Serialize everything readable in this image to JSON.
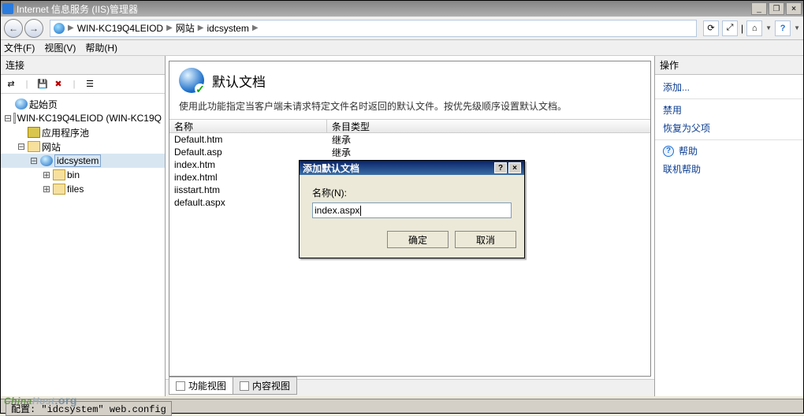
{
  "window": {
    "title": "Internet 信息服务 (IIS)管理器",
    "min_btn": "_",
    "restore_btn": "❐",
    "close_btn": "×"
  },
  "nav": {
    "back": "←",
    "fwd": "→",
    "crumbs": [
      "WIN-KC19Q4LEIOD",
      "网站",
      "idcsystem"
    ],
    "sep": "▶",
    "refresh": "⟳",
    "explore": "⤢",
    "home": "⌂",
    "help": "?"
  },
  "menu": {
    "file": "文件(F)",
    "view": "视图(V)",
    "help": "帮助(H)"
  },
  "left": {
    "header": "连接",
    "tb": {
      "connect": "⇄",
      "save": "💾",
      "delete": "✖",
      "sep": "|"
    },
    "tree": {
      "start": "起始页",
      "host": "WIN-KC19Q4LEIOD (WIN-KC19Q",
      "apppool": "应用程序池",
      "sites": "网站",
      "site": "idcsystem",
      "bin": "bin",
      "files": "files",
      "expand": "⊟",
      "expand2": "⊞"
    }
  },
  "center": {
    "title": "默认文档",
    "desc": "使用此功能指定当客户端未请求特定文件名时返回的默认文件。按优先级顺序设置默认文档。",
    "cols": {
      "name": "名称",
      "type": "条目类型"
    },
    "rows": [
      {
        "name": "Default.htm",
        "type": "继承"
      },
      {
        "name": "Default.asp",
        "type": "继承"
      },
      {
        "name": "index.htm",
        "type": ""
      },
      {
        "name": "index.html",
        "type": ""
      },
      {
        "name": "iisstart.htm",
        "type": ""
      },
      {
        "name": "default.aspx",
        "type": ""
      }
    ],
    "tabs": {
      "features": "功能视图",
      "content": "内容视图"
    }
  },
  "right": {
    "header": "操作",
    "add": "添加...",
    "disable": "禁用",
    "revert": "恢复为父项",
    "help": "帮助",
    "online": "联机帮助"
  },
  "dialog": {
    "title": "添加默认文档",
    "help": "?",
    "close": "×",
    "label": "名称(N):",
    "value": "index.aspx",
    "ok": "确定",
    "cancel": "取消"
  },
  "status": {
    "text": "配置: \"idcsystem\" web.config"
  },
  "watermark": {
    "a": "China",
    "b": "Host",
    "c": ".org"
  }
}
